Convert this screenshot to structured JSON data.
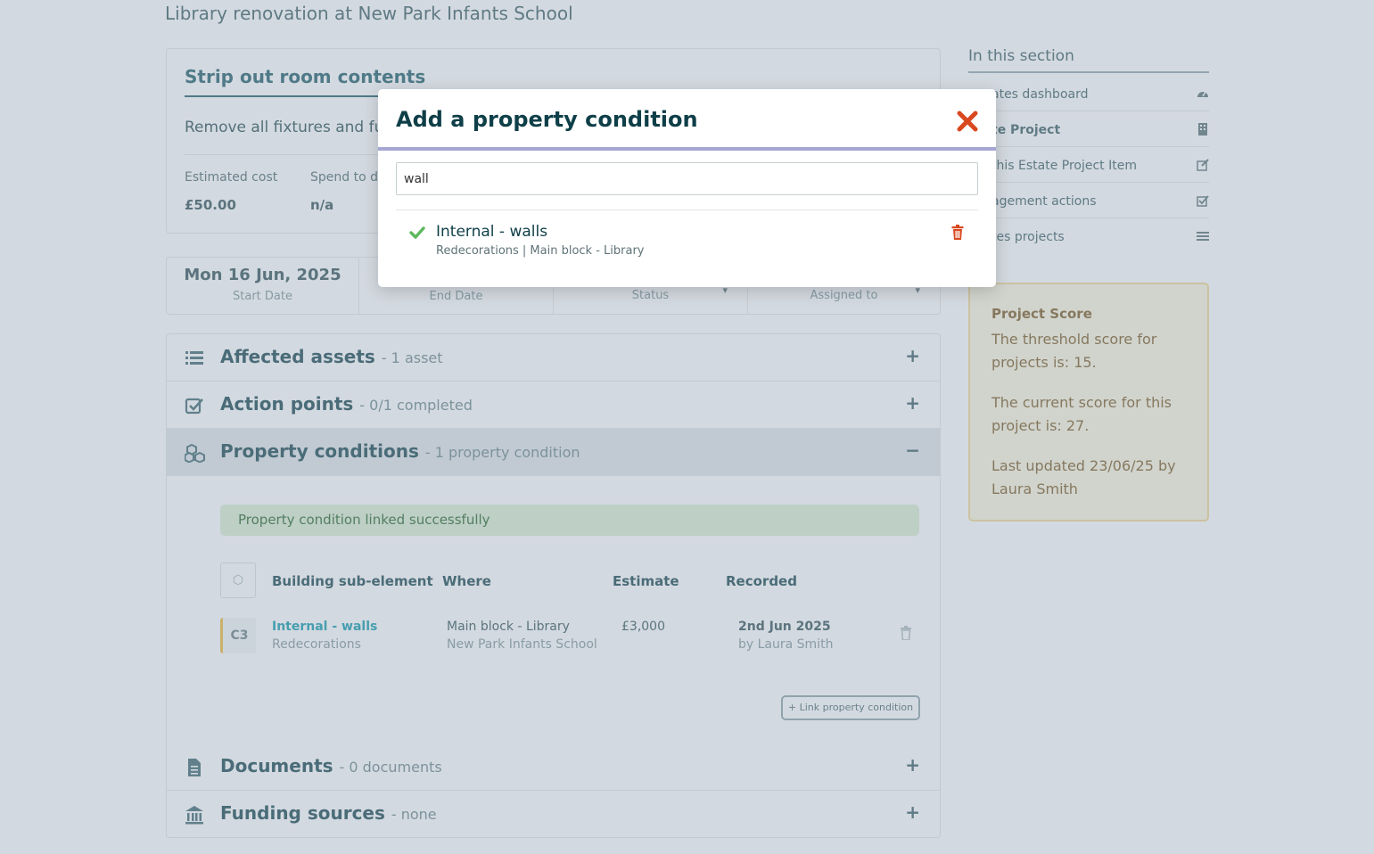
{
  "page": {
    "title": "Library renovation at New Park Infants School"
  },
  "item": {
    "title": "Strip out room contents",
    "description": "Remove all fixtures and fur",
    "metrics": [
      {
        "label": "Estimated cost",
        "value": "£50.00"
      },
      {
        "label": "Spend to da",
        "value": "n/a"
      }
    ]
  },
  "dates": {
    "start_value": "Mon 16 Jun, 2025",
    "start_label": "Start Date",
    "end_label": "End Date",
    "status_label": "Status",
    "assigned_label": "Assigned to"
  },
  "accordion": [
    {
      "title": "Affected assets",
      "sub": "- 1 asset",
      "toggle": "+",
      "icon": "list-icon"
    },
    {
      "title": "Action points",
      "sub": "- 0/1 completed",
      "toggle": "+",
      "icon": "checkbox-icon"
    },
    {
      "title": "Property conditions",
      "sub": "- 1 property condition",
      "toggle": "−",
      "icon": "cubes-icon"
    },
    {
      "title": "Documents",
      "sub": "- 0 documents",
      "toggle": "+",
      "icon": "document-icon"
    },
    {
      "title": "Funding sources",
      "sub": "- none",
      "toggle": "+",
      "icon": "bank-icon"
    }
  ],
  "property_conditions": {
    "alert": "Property condition linked successfully",
    "headers": {
      "element": "Building sub-element",
      "where": "Where",
      "estimate": "Estimate",
      "recorded": "Recorded"
    },
    "rows": [
      {
        "grade": "C3",
        "element": "Internal - walls",
        "category": "Redecorations",
        "where_1": "Main block - Library",
        "where_2": "New Park Infants School",
        "estimate": "£3,000",
        "recorded_date": "2nd Jun 2025",
        "recorded_by": "by Laura Smith"
      }
    ],
    "link_button": "+ Link property condition"
  },
  "sidebar": {
    "title": "In this section",
    "items": [
      {
        "label": "ates dashboard",
        "icon": "dashboard-icon"
      },
      {
        "label": "te Project",
        "icon": "building-icon"
      },
      {
        "label": "this Estate Project Item",
        "icon": "edit-icon"
      },
      {
        "label": "agement actions",
        "icon": "checkbox-icon"
      },
      {
        "label": "tes projects",
        "icon": "list-icon"
      }
    ],
    "score": {
      "title": "Project Score",
      "line1": "The threshold score for projects is: 15.",
      "line2": "The current score for this project is: 27.",
      "line3": "Last updated 23/06/25 by Laura Smith"
    }
  },
  "modal": {
    "title": "Add a property condition",
    "search_value": "wall",
    "result": {
      "name": "Internal - walls",
      "meta": "Redecorations | Main block - Library"
    }
  },
  "colors": {
    "accent": "#0f3f48",
    "close": "#d9481f",
    "check": "#5cb85c",
    "delete": "#d9481f",
    "header_border": "#a6a6d4"
  }
}
